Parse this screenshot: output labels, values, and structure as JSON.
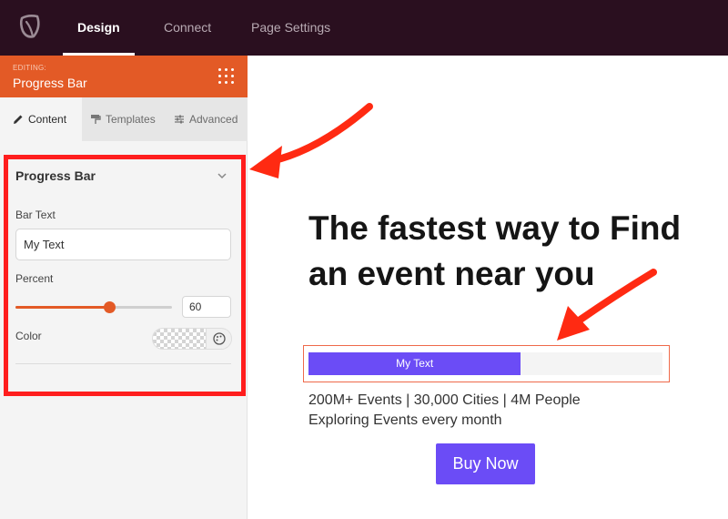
{
  "nav": {
    "tabs": [
      {
        "label": "Design"
      },
      {
        "label": "Connect"
      },
      {
        "label": "Page Settings"
      }
    ]
  },
  "editor": {
    "editing_label": "EDITING:",
    "editing_title": "Progress Bar",
    "tabs": [
      {
        "label": "Content",
        "icon": "pencil-icon"
      },
      {
        "label": "Templates",
        "icon": "paint-roller-icon"
      },
      {
        "label": "Advanced",
        "icon": "sliders-icon"
      }
    ],
    "section": {
      "title": "Progress Bar",
      "bar_text_label": "Bar Text",
      "bar_text_value": "My Text",
      "percent_label": "Percent",
      "percent_value": "60",
      "color_label": "Color"
    }
  },
  "preview": {
    "headline": "The fastest way to Find an event near you",
    "progress_text": "My Text",
    "progress_percent": 60,
    "stats_line1": "200M+ Events | 30,000 Cities | 4M People",
    "stats_line2": "Exploring Events every month",
    "button_label": "Buy Now"
  },
  "colors": {
    "topbar": "#2a0f1f",
    "accent": "#e35a26",
    "progress_fill": "#6b4cf6",
    "annotation": "#ff1e1e"
  }
}
